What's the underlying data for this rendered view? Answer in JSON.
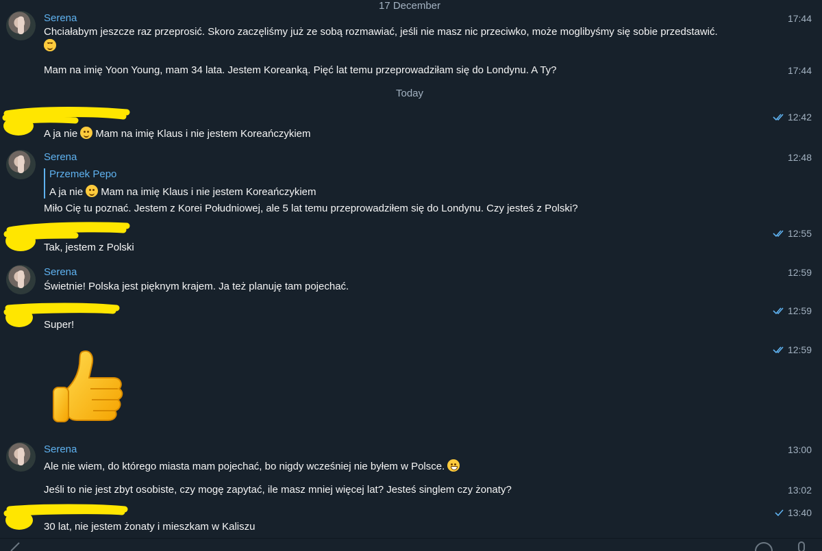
{
  "chat": {
    "date_separators": {
      "december": "17 December",
      "today": "Today"
    },
    "messages": [
      {
        "sender": "Serena",
        "text": "Chciałabym jeszcze raz przeprosić. Skoro zaczęliśmy już ze sobą rozmawiać, jeśli nie masz nic przeciwko, może moglibyśmy się sobie przedstawić.",
        "emoji": "smiling-face-with-smiling-eyes",
        "time": "17:44"
      },
      {
        "sender": "",
        "text": "Mam na imię Yoon Young, mam 34 lata. Jestem Koreanką. Pięć lat temu przeprowadziłam się do Londynu. A Ty?",
        "time": "17:44"
      },
      {
        "sender": "",
        "text_before": "A ja nie",
        "emoji": "slightly-smiling-face",
        "text_after": "Mam na imię Klaus i nie jestem Koreańczykiem",
        "time": "12:42",
        "read_status": "double-check"
      },
      {
        "sender": "Serena",
        "reply": {
          "name": "Przemek Pepo",
          "text_before": "A ja nie",
          "emoji": "slightly-smiling-face",
          "text_after": "Mam na imię Klaus i nie jestem Koreańczykiem"
        },
        "text": "Miło Cię tu poznać. Jestem z Korei Południowej, ale 5 lat temu przeprowadziłem się do Londynu. Czy jesteś z Polski?",
        "time": "12:48"
      },
      {
        "sender": "",
        "text": "Tak, jestem z Polski",
        "time": "12:55",
        "read_status": "double-check"
      },
      {
        "sender": "Serena",
        "text": "Świetnie! Polska jest pięknym krajem. Ja też planuję tam pojechać.",
        "time": "12:59"
      },
      {
        "sender": "",
        "text": "Super!",
        "time": "12:59",
        "read_status": "double-check"
      },
      {
        "sender": "",
        "sticker": "thumbs-up",
        "time": "12:59",
        "read_status": "double-check"
      },
      {
        "sender": "Serena",
        "text": "Ale nie wiem, do którego miasta mam pojechać, bo nigdy wcześniej nie byłem w Polsce.",
        "emoji": "grinning-face",
        "time": "13:00"
      },
      {
        "sender": "",
        "text": "Jeśli to nie jest zbyt osobiste, czy mogę zapytać, ile masz mniej więcej lat? Jesteś singlem czy żonaty?",
        "time": "13:02"
      },
      {
        "sender": "",
        "text": "30 lat, nie jestem żonaty i mieszkam w Kaliszu",
        "time": "13:40",
        "read_status": "single-check"
      }
    ]
  },
  "colors": {
    "background": "#17212b",
    "accent": "#5fb2f0",
    "meta": "#a3b2c1",
    "redaction": "#ffe600"
  }
}
